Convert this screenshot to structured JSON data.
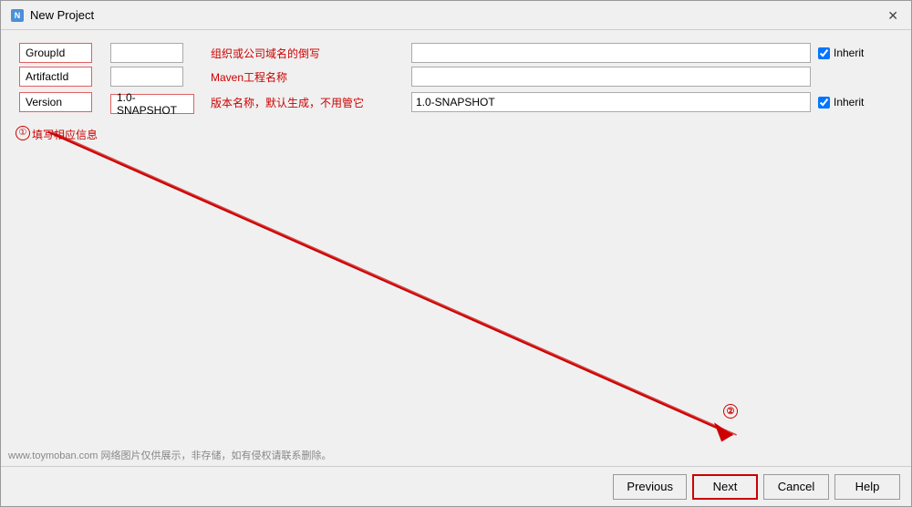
{
  "window": {
    "title": "New Project",
    "close_label": "✕"
  },
  "form": {
    "rows": [
      {
        "label": "GroupId",
        "value": "",
        "description": "组织或公司域名的倒写",
        "has_inherit": true,
        "inherit_checked": true,
        "inherit_label": "Inherit"
      },
      {
        "label": "ArtifactId",
        "value": "",
        "description": "Maven工程名称",
        "has_inherit": false,
        "inherit_checked": false,
        "inherit_label": ""
      },
      {
        "label": "Version",
        "value": "1.0-SNAPSHOT",
        "description": "版本名称，默认生成，不用管它",
        "has_inherit": true,
        "inherit_checked": true,
        "inherit_label": "Inherit"
      }
    ]
  },
  "annotation1": {
    "circle": "①",
    "text": "填写相应信息"
  },
  "annotation2": {
    "circle": "②"
  },
  "footer": {
    "previous_label": "Previous",
    "next_label": "Next",
    "cancel_label": "Cancel",
    "help_label": "Help"
  },
  "watermark": "www.toymoban.com 网络图片仅供展示，非存储，如有侵权请联系删除。"
}
